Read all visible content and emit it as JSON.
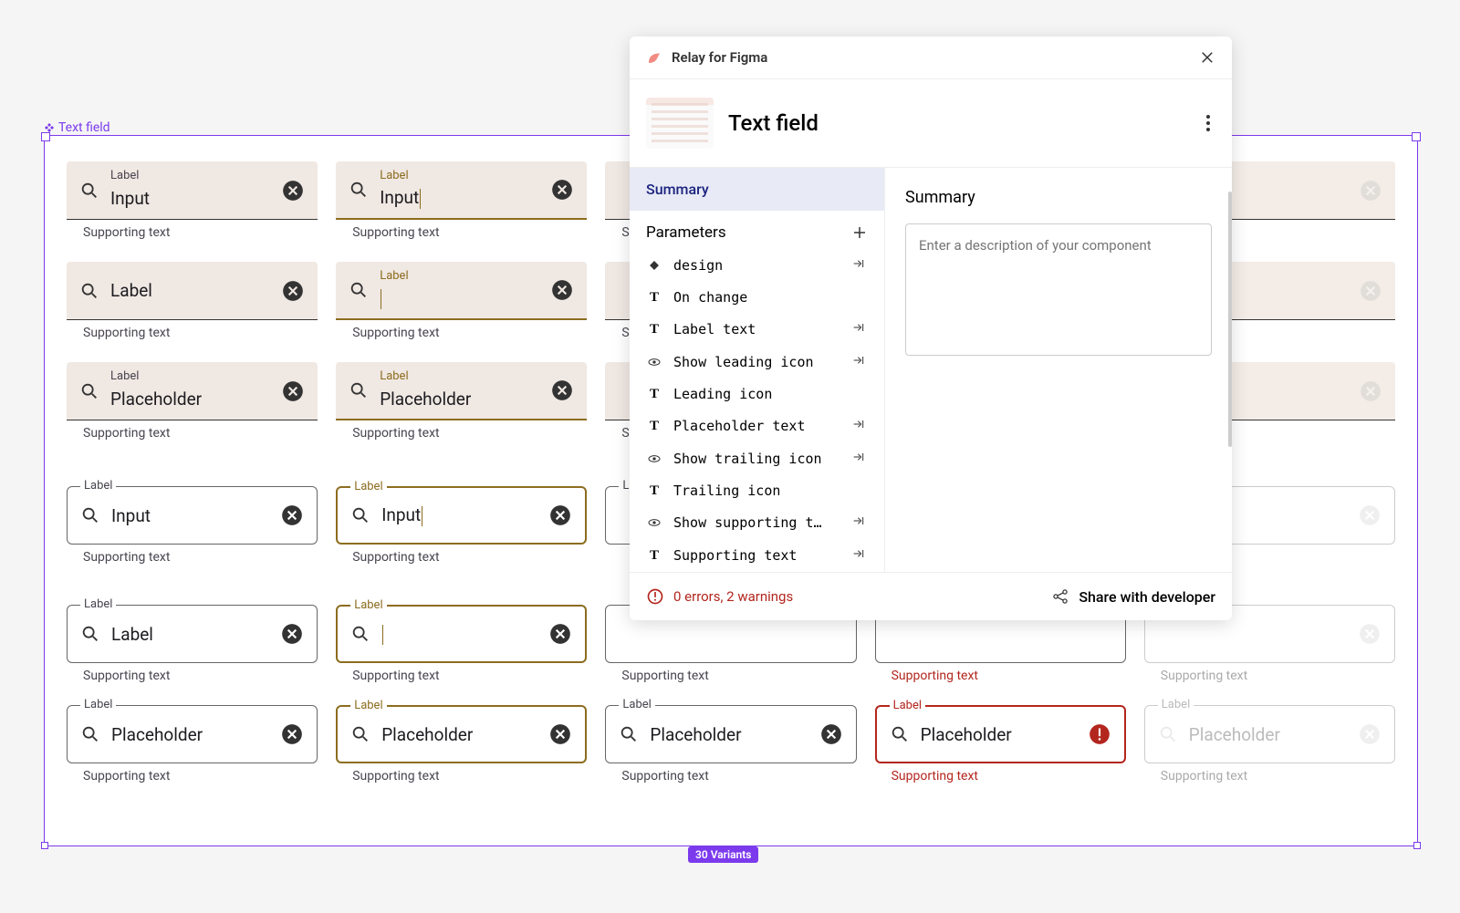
{
  "frame": {
    "name": "Text field",
    "variants": "30 Variants"
  },
  "modal": {
    "title": "Relay for Figma",
    "component_name": "Text field",
    "tabs": {
      "summary": "Summary"
    },
    "params_header": "Parameters",
    "params": [
      {
        "icon": "diamond",
        "label": "design",
        "action": true
      },
      {
        "icon": "T",
        "label": "On change",
        "action": false
      },
      {
        "icon": "T",
        "label": "Label text",
        "action": true
      },
      {
        "icon": "eye",
        "label": "Show leading icon",
        "action": true
      },
      {
        "icon": "T",
        "label": "Leading icon",
        "action": false
      },
      {
        "icon": "T",
        "label": "Placeholder text",
        "action": true
      },
      {
        "icon": "eye",
        "label": "Show trailing icon",
        "action": true
      },
      {
        "icon": "T",
        "label": "Trailing icon",
        "action": false
      },
      {
        "icon": "eye",
        "label": "Show supporting t…",
        "action": true
      },
      {
        "icon": "T",
        "label": "Supporting text",
        "action": true
      }
    ],
    "right_pane": {
      "heading": "Summary",
      "placeholder": "Enter a description of your component"
    },
    "footer": {
      "errors": "0 errors, 2 warnings",
      "share": "Share with developer"
    }
  },
  "fields": {
    "label": "Label",
    "input": "Input",
    "placeholder": "Placeholder",
    "support": "Supporting text"
  }
}
